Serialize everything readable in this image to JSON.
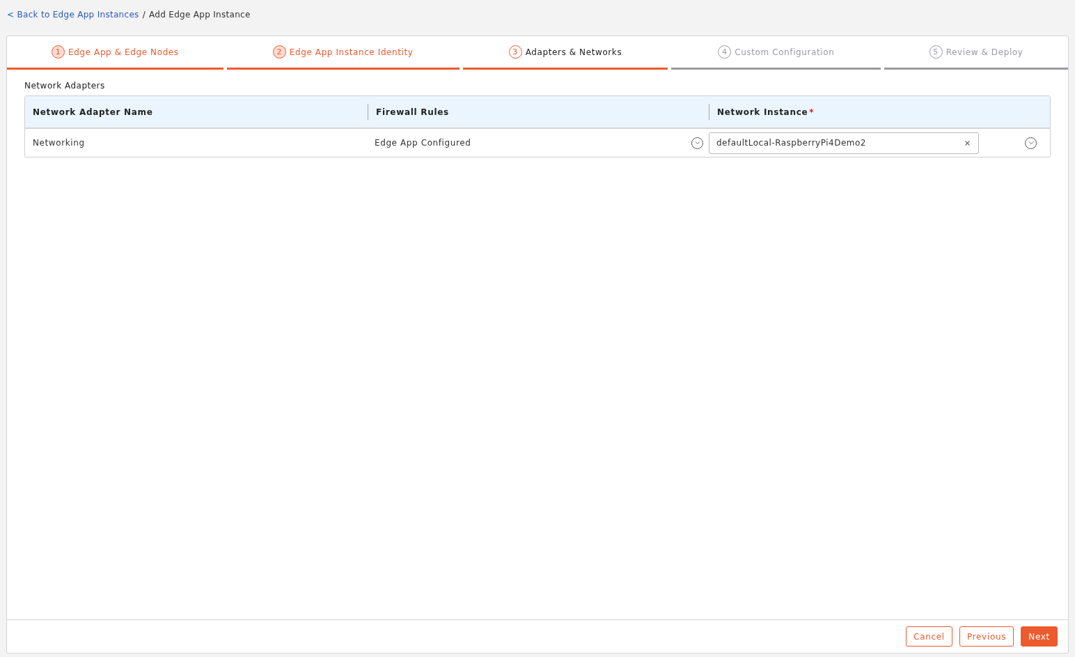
{
  "breadcrumb": {
    "back_link": "< Back to Edge App Instances",
    "separator": "/",
    "current": "Add Edge App Instance"
  },
  "steps": [
    {
      "number": "1",
      "label": "Edge App & Edge Nodes",
      "completed": true,
      "selected": false
    },
    {
      "number": "2",
      "label": "Edge App Instance Identity",
      "completed": true,
      "selected": false
    },
    {
      "number": "3",
      "label": "Adapters & Networks",
      "completed": false,
      "selected": true
    },
    {
      "number": "4",
      "label": "Custom Configuration",
      "completed": false,
      "selected": false
    },
    {
      "number": "5",
      "label": "Review & Deploy",
      "completed": false,
      "selected": false
    }
  ],
  "section_title": "Network Adapters",
  "table": {
    "columns": [
      {
        "label": "Network Adapter Name"
      },
      {
        "label": "Firewall Rules"
      },
      {
        "label": "Network Instance",
        "required_mark": "*"
      }
    ],
    "rows": [
      {
        "adapter": "Networking",
        "firewall": "Edge App Configured",
        "network_instance": "defaultLocal-RaspberryPi4Demo2"
      }
    ]
  },
  "footer": {
    "buttons": [
      {
        "label": "Cancel",
        "kind": "outline"
      },
      {
        "label": "Previous",
        "kind": "outline"
      },
      {
        "label": "Next",
        "kind": "primary"
      }
    ]
  }
}
